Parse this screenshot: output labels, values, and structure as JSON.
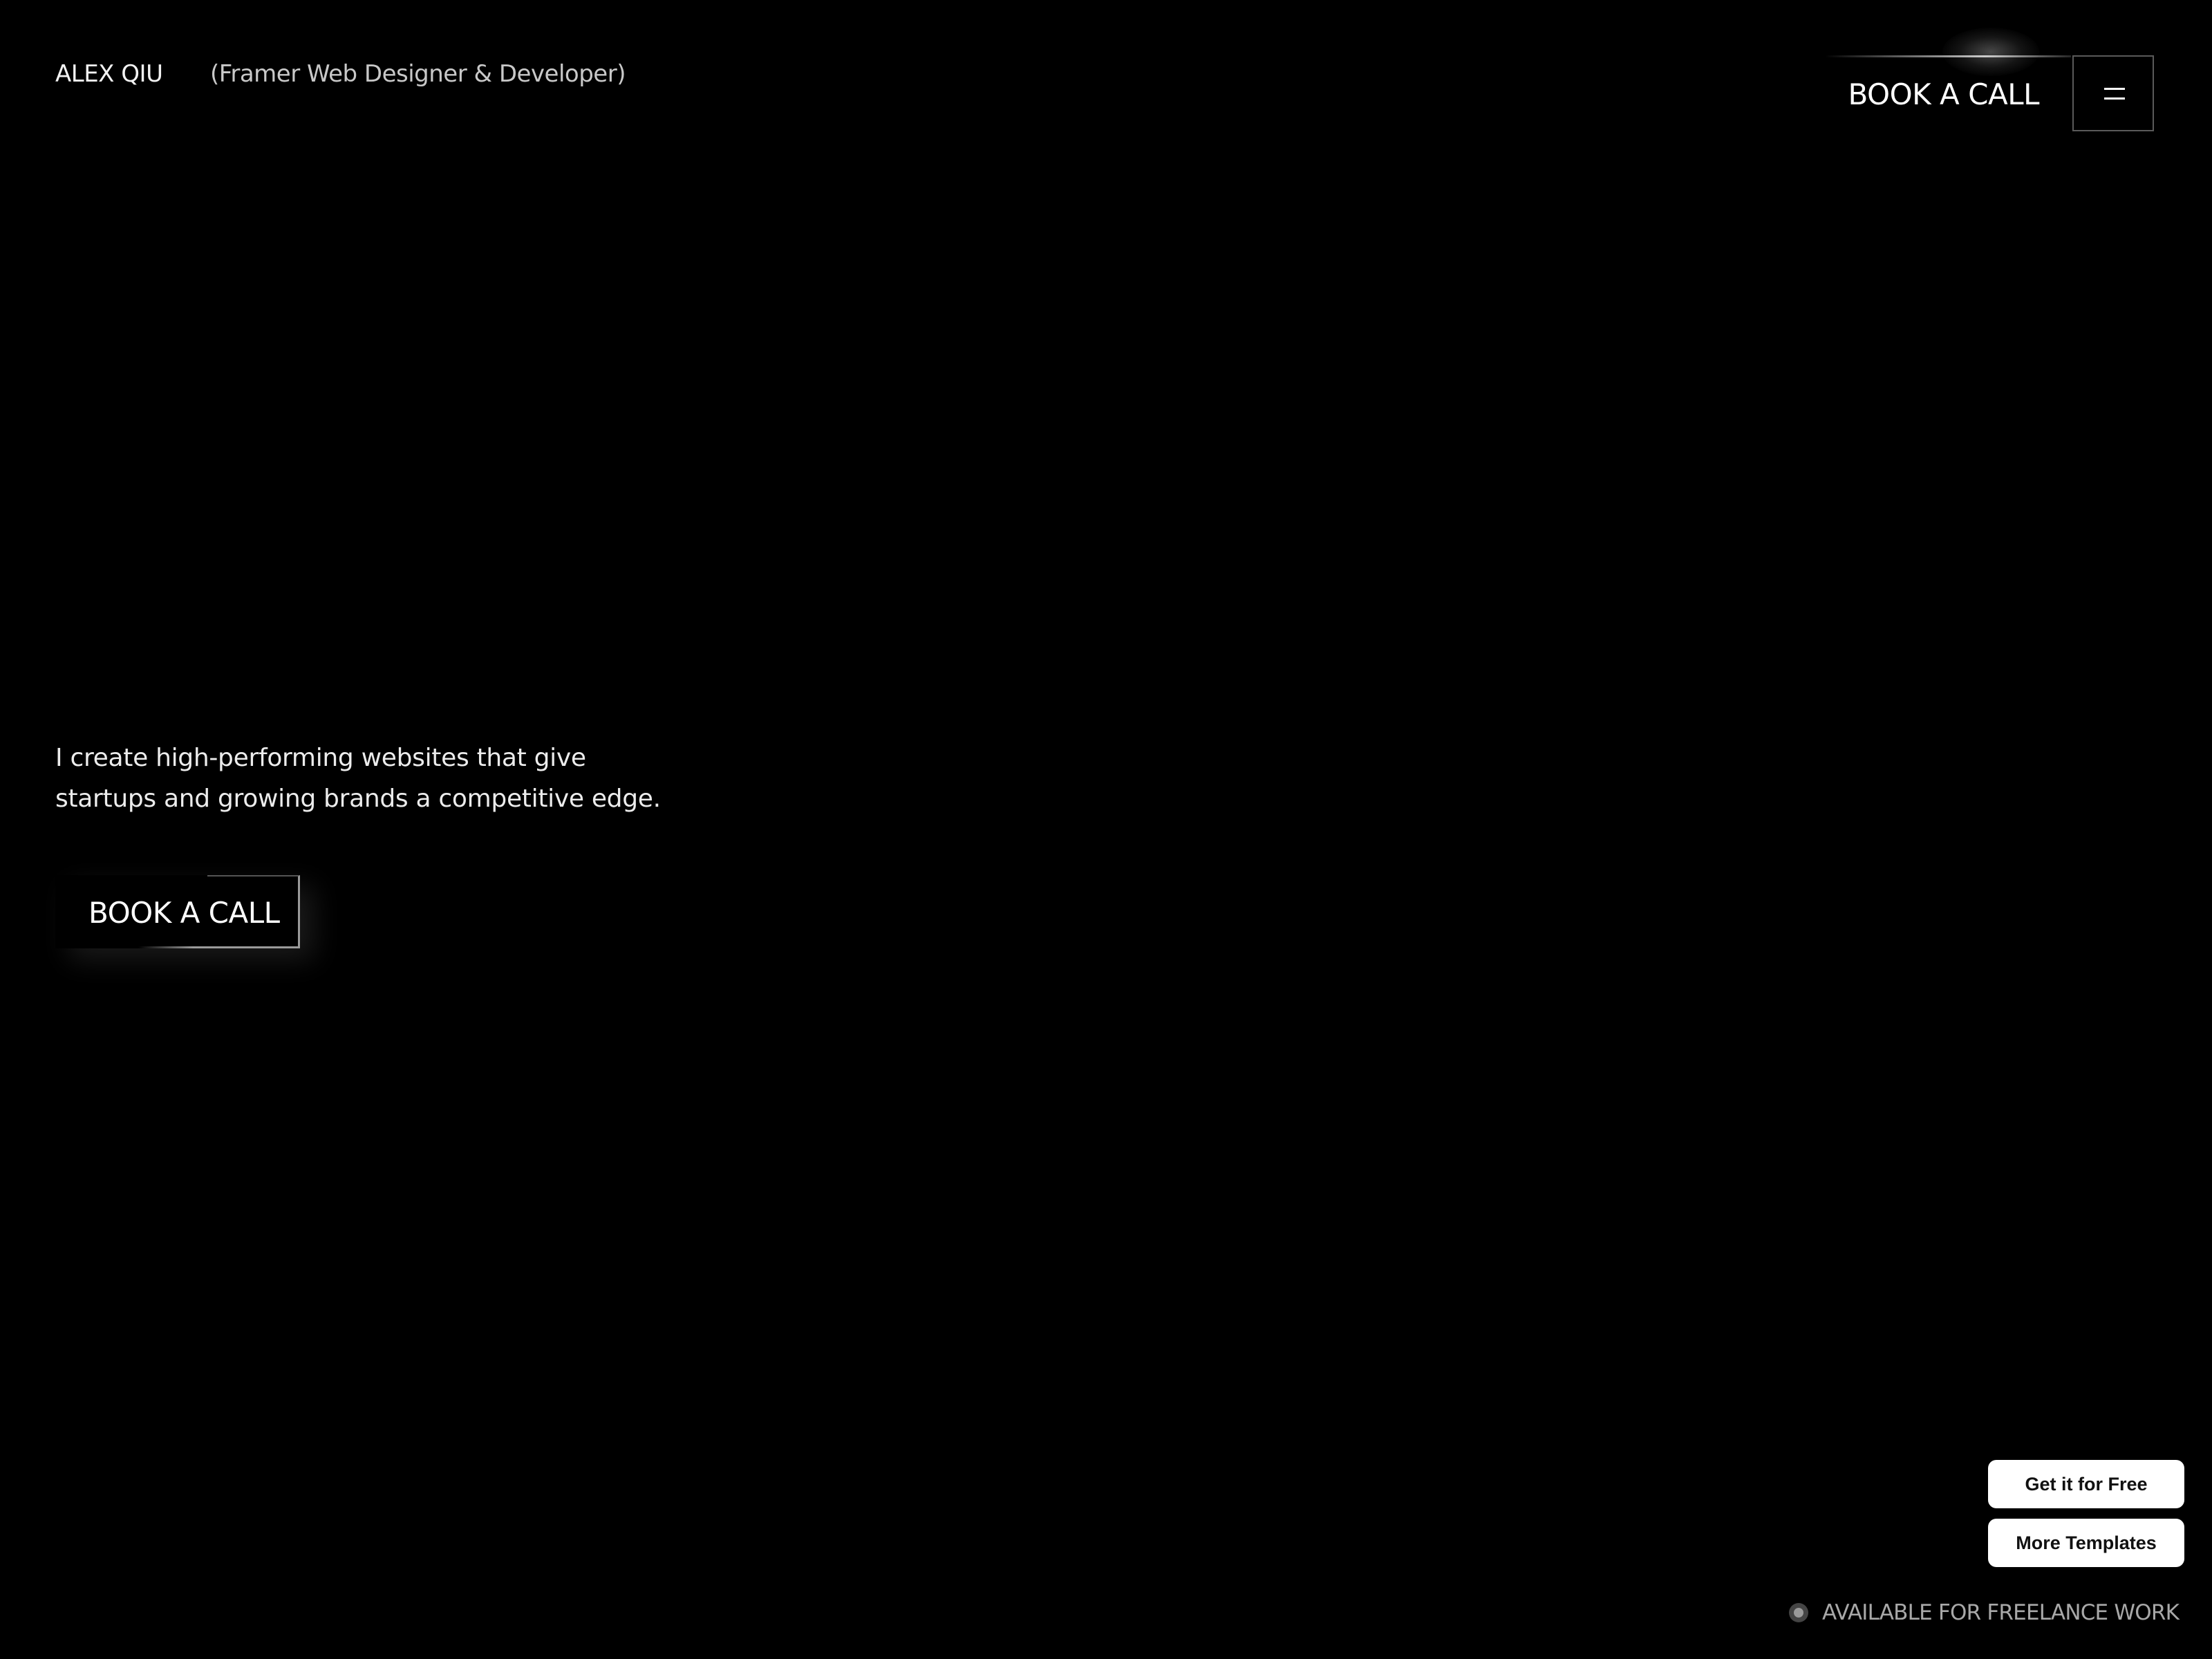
{
  "header": {
    "brand": "ALEX QIU",
    "role": "(Framer Web Designer & Developer)",
    "cta_label": "BOOK A CALL",
    "menu_icon": "hamburger-menu-icon"
  },
  "hero": {
    "lines": [
      "I create high-performing websites that give",
      "startups and growing brands a competitive edge."
    ],
    "cta_label": "BOOK A CALL"
  },
  "floating_buttons": {
    "get_free_label": "Get it for Free",
    "more_templates_label": "More Templates"
  },
  "availability": {
    "icon": "status-dot-icon",
    "text": "AVAILABLE FOR FREELANCE WORK"
  },
  "colors": {
    "background": "#000000",
    "text": "#ffffff",
    "muted_text": "#a8a8a8",
    "pill_background": "#ffffff",
    "pill_text": "#111111"
  }
}
